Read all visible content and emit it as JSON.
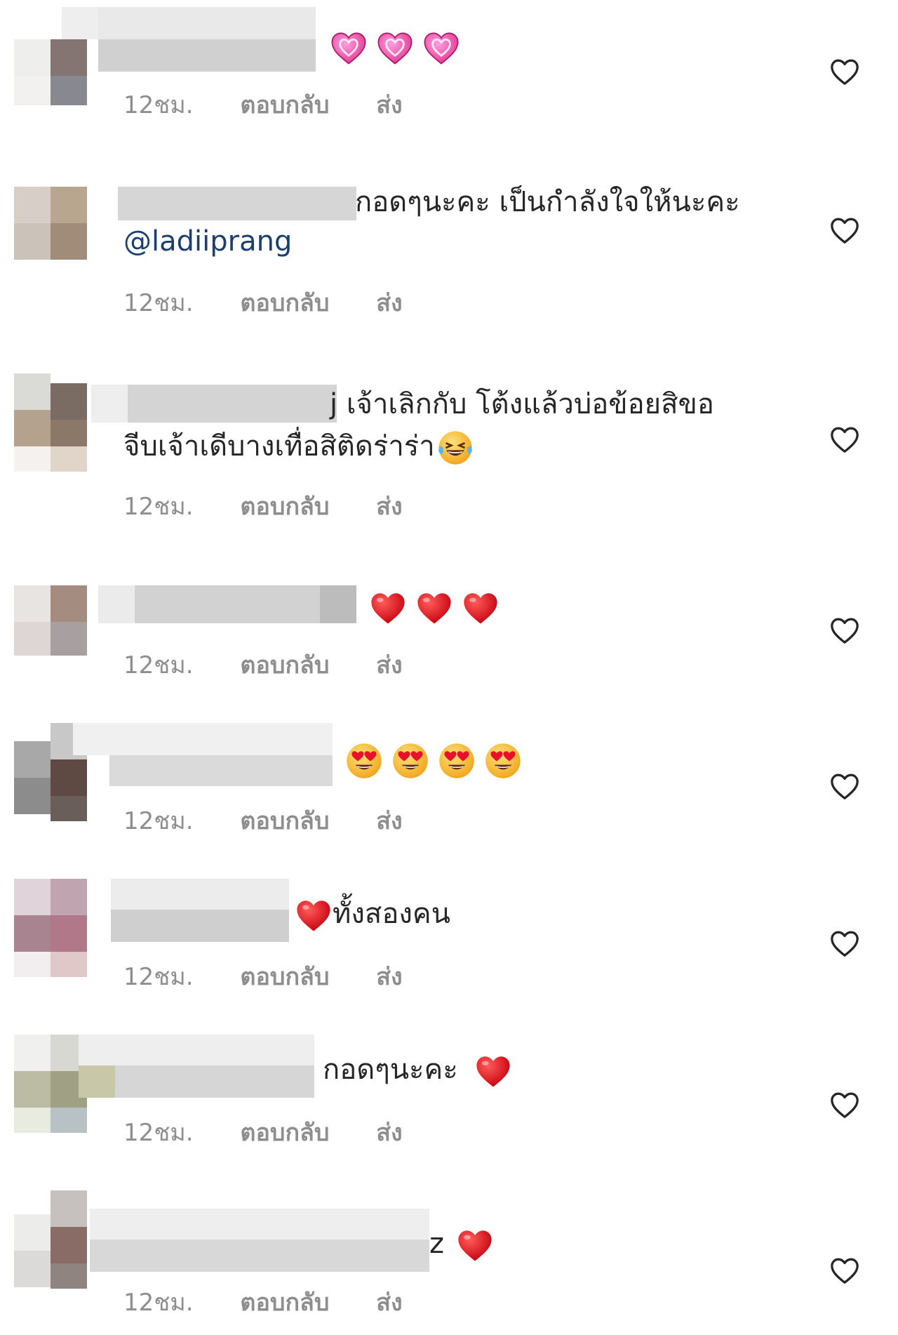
{
  "comments": [
    {
      "text": "",
      "emoji": [
        "pink-heart",
        "pink-heart",
        "pink-heart"
      ],
      "time": "12ชม.",
      "reply": "ตอบกลับ",
      "send": "ส่ง"
    },
    {
      "text": "กอดๆนะคะ เป็นกำลังใจให้นะคะ",
      "mention": "@ladiiprang",
      "time": "12ชม.",
      "reply": "ตอบกลับ",
      "send": "ส่ง"
    },
    {
      "text": "j เจ้าเลิกกับ โต้งแล้วบ่อข้อยสิขอ",
      "text2": "จีบเจ้าเดีบางเทื่อสิติดร่าร่า",
      "emoji": [
        "laughing-tears"
      ],
      "time": "12ชม.",
      "reply": "ตอบกลับ",
      "send": "ส่ง"
    },
    {
      "text": "",
      "emoji": [
        "red-heart",
        "red-heart",
        "red-heart"
      ],
      "time": "12ชม.",
      "reply": "ตอบกลับ",
      "send": "ส่ง"
    },
    {
      "text": "",
      "emoji": [
        "heart-eyes",
        "heart-eyes",
        "heart-eyes",
        "heart-eyes"
      ],
      "time": "12ชม.",
      "reply": "ตอบกลับ",
      "send": "ส่ง"
    },
    {
      "text": "ทั้งสองคน",
      "emoji": [
        "red-heart"
      ],
      "time": "12ชม.",
      "reply": "ตอบกลับ",
      "send": "ส่ง"
    },
    {
      "text": "กอดๆนะคะ",
      "emoji": [
        "red-heart"
      ],
      "time": "12ชม.",
      "reply": "ตอบกลับ",
      "send": "ส่ง"
    },
    {
      "text": "z",
      "emoji": [
        "red-heart"
      ],
      "time": "12ชม.",
      "reply": "ตอบกลับ",
      "send": "ส่ง"
    }
  ],
  "icons": {
    "like": "heart-outline-icon"
  },
  "colors": {
    "meta": "#8e8e8e",
    "mention": "#1d3f6e",
    "text": "#262626"
  }
}
